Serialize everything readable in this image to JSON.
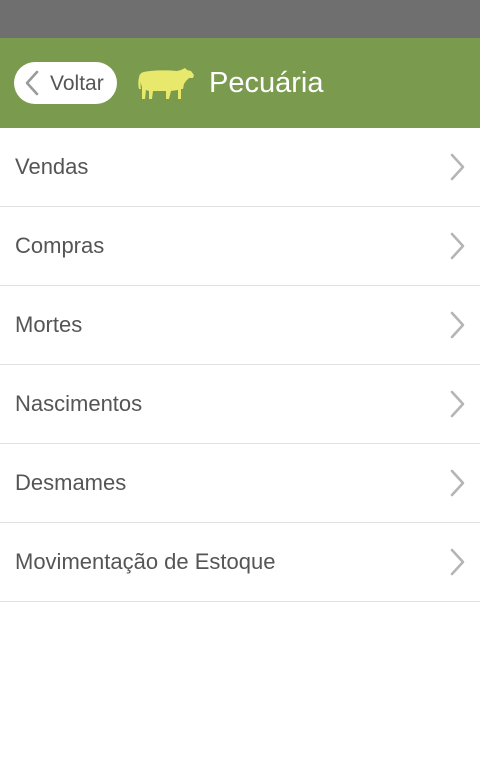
{
  "header": {
    "back_label": "Voltar",
    "title": "Pecuária",
    "logo_icon": "cow-icon",
    "background_color": "#7a9a4e",
    "logo_color": "#e8e86c"
  },
  "menu": {
    "items": [
      {
        "label": "Vendas",
        "icon": "chevron-right-icon"
      },
      {
        "label": "Compras",
        "icon": "chevron-right-icon"
      },
      {
        "label": "Mortes",
        "icon": "chevron-right-icon"
      },
      {
        "label": "Nascimentos",
        "icon": "chevron-right-icon"
      },
      {
        "label": "Desmames",
        "icon": "chevron-right-icon"
      },
      {
        "label": "Movimentação de Estoque",
        "icon": "chevron-right-icon"
      }
    ]
  }
}
